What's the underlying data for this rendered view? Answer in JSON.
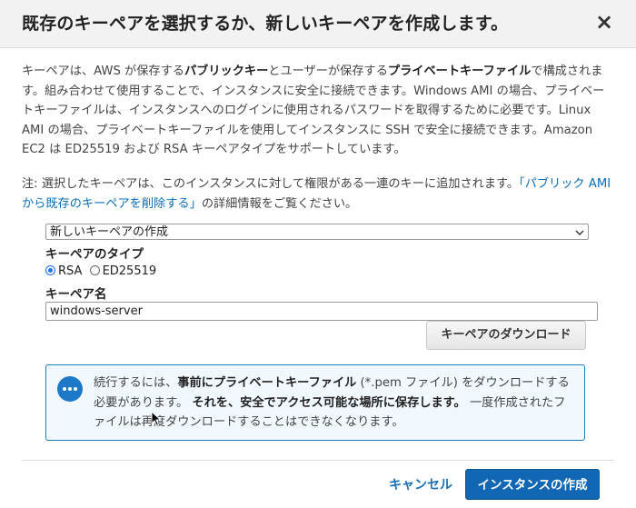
{
  "dialog": {
    "title": "既存のキーペアを選択するか、新しいキーペアを作成します。",
    "close_label": "×"
  },
  "intro": {
    "p1": "キーペアは、AWS が保存する",
    "b1": "パブリックキー",
    "p2": "とユーザーが保存する",
    "b2": "プライベートキーファイル",
    "p3": "で構成されます。組み合わせて使用することで、インスタンスに安全に接続できます。Windows AMI の場合、プライベートキーファイルは、インスタンスへのログインに使用されるパスワードを取得するために必要です。Linux AMI の場合、プライベートキーファイルを使用してインスタンスに SSH で安全に接続できます。Amazon EC2 は ED25519 および RSA キーペアタイプをサポートしています。"
  },
  "note": {
    "prefix": "注: 選択したキーペアは、このインスタンスに対して権限がある一連のキーに追加されます。",
    "link": "「パブリック AMI から既存のキーペアを削除する」",
    "suffix": "の詳細情報をご覧ください。"
  },
  "form": {
    "select_value": "新しいキーペアの作成",
    "key_type_label": "キーペアのタイプ",
    "radio_rsa": "RSA",
    "radio_ed25519": "ED25519",
    "key_name_label": "キーペア名",
    "key_name_value": "windows-server",
    "download_button": "キーペアのダウンロード"
  },
  "info": {
    "t1": "続行するには、",
    "b1": "事前にプライベートキーファイル",
    "t2": " (*.pem ファイル) をダウンロードする必要があります。",
    "b2": "それを、安全でアクセス可能な場所に保存します。",
    "t3": "一度作成されたファイルは再度ダウンロードすることはできなくなります。"
  },
  "footer": {
    "cancel": "キャンセル",
    "launch": "インスタンスの作成"
  },
  "colors": {
    "accent": "#1167b4",
    "link": "#0b6eb8",
    "info_border": "#1b7fb9",
    "info_bg": "#f1f9ff"
  },
  "icons": [
    "close-icon",
    "chevron-down-icon",
    "speech-bubble-info-icon",
    "mouse-cursor-icon"
  ]
}
